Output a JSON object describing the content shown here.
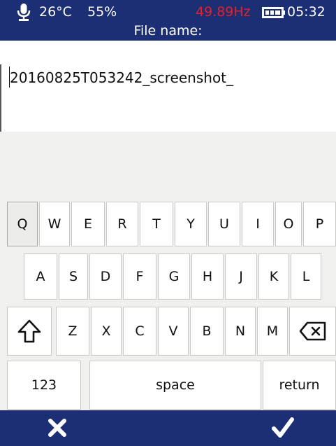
{
  "status": {
    "mic_icon": "microphone-icon",
    "temperature": "26°C",
    "humidity": "55%",
    "frequency": "49.89Hz",
    "frequency_color": "#e5202a",
    "battery_icon": "battery-icon",
    "time": "05:32"
  },
  "header": {
    "title": "File name:"
  },
  "filename": {
    "value": "20160825T053242_screenshot_"
  },
  "keyboard": {
    "row1": [
      "Q",
      "W",
      "E",
      "R",
      "T",
      "Y",
      "U",
      "I",
      "O",
      "P"
    ],
    "row2": [
      "A",
      "S",
      "D",
      "F",
      "G",
      "H",
      "J",
      "K",
      "L"
    ],
    "row3": [
      "Z",
      "X",
      "C",
      "V",
      "B",
      "N",
      "M"
    ],
    "shift_icon": "shift-arrow-icon",
    "backspace_icon": "backspace-icon",
    "numbers_label": "123",
    "space_label": "space",
    "return_label": "return"
  },
  "footer": {
    "cancel_icon": "close-icon",
    "confirm_icon": "checkmark-icon"
  },
  "colors": {
    "bar_background": "#1d2f74",
    "keyboard_background": "#f0f0ef"
  }
}
